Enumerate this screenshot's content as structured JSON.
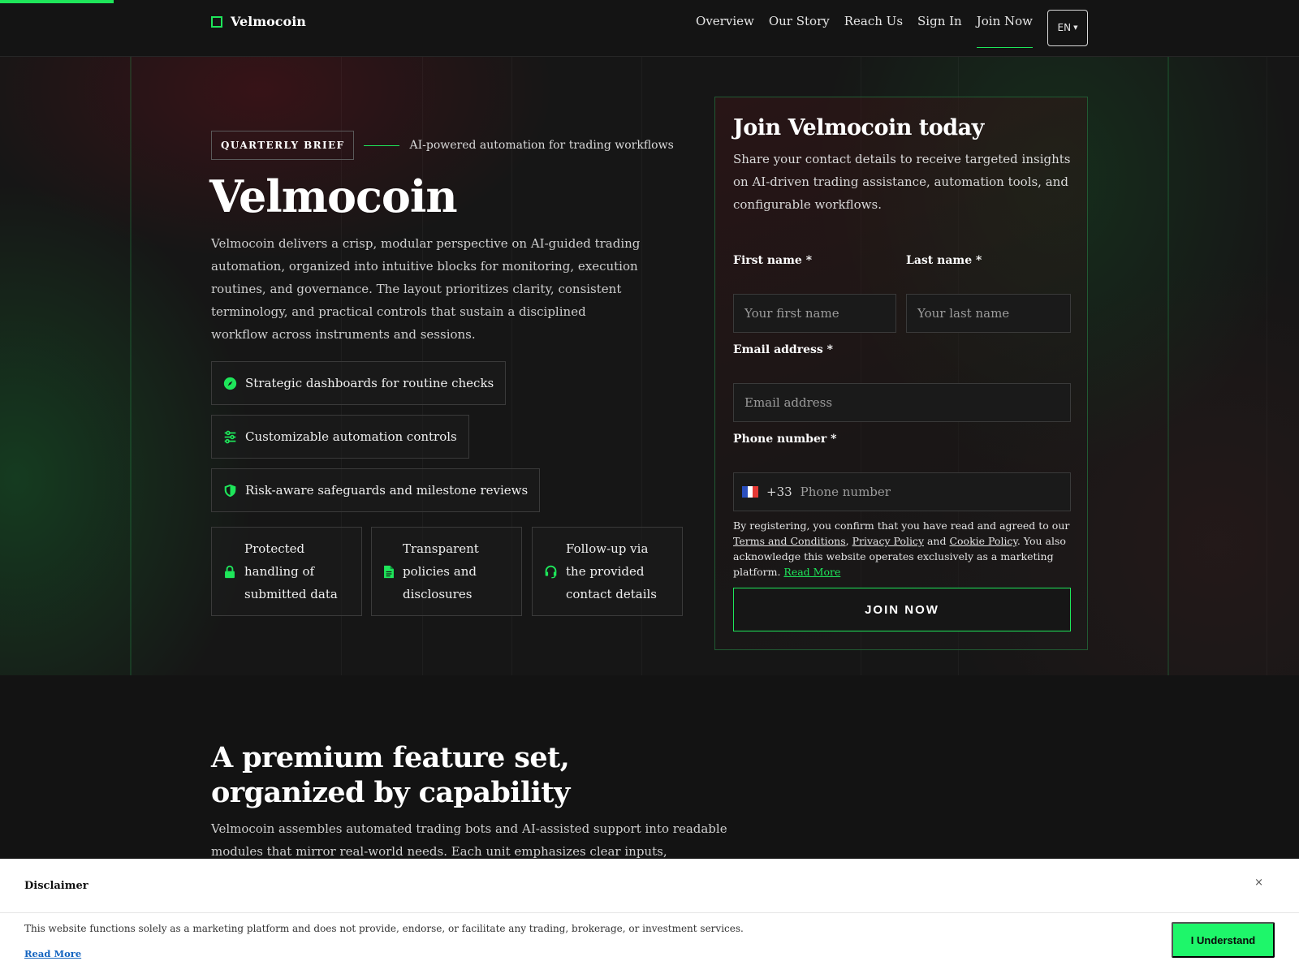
{
  "header": {
    "brand": "Velmocoin",
    "nav": [
      "Overview",
      "Our Story",
      "Reach Us",
      "Sign In",
      "Join Now"
    ],
    "active_nav": "Join Now",
    "language": "EN"
  },
  "hero": {
    "badge": "QUARTERLY BRIEF",
    "tagline": "AI-powered automation for trading workflows",
    "title": "Velmocoin",
    "description": "Velmocoin delivers a crisp, modular perspective on AI-guided trading automation, organized into intuitive blocks for monitoring, execution routines, and governance. The layout prioritizes clarity, consistent terminology, and practical controls that sustain a disciplined workflow across instruments and sessions.",
    "features": [
      {
        "icon": "compass-icon",
        "label": "Strategic dashboards for routine checks"
      },
      {
        "icon": "sliders-icon",
        "label": "Customizable automation controls"
      },
      {
        "icon": "shield-icon",
        "label": "Risk-aware safeguards and milestone reviews"
      }
    ],
    "cards": [
      {
        "icon": "lock-icon",
        "label": "Protected handling of submitted data"
      },
      {
        "icon": "document-icon",
        "label": "Transparent policies and disclosures"
      },
      {
        "icon": "headset-icon",
        "label": "Follow-up via the provided contact details"
      }
    ]
  },
  "form": {
    "title": "Join Velmocoin today",
    "subtitle": "Share your contact details to receive targeted insights on AI-driven trading assistance, automation tools, and configurable workflows.",
    "first_name_label": "First name *",
    "first_name_placeholder": "Your first name",
    "last_name_label": "Last name *",
    "last_name_placeholder": "Your last name",
    "email_label": "Email address *",
    "email_placeholder": "Email address",
    "phone_label": "Phone number *",
    "phone_code": "+33",
    "phone_placeholder": "Phone number",
    "legal_prefix": "By registering, you confirm that you have read and agreed to our ",
    "terms": "Terms and Conditions",
    "comma": ", ",
    "privacy": "Privacy Policy",
    "and": " and ",
    "cookie": "Cookie Policy",
    "legal_suffix": ". You also acknowledge this website operates exclusively as a marketing platform. ",
    "read_more": "Read More",
    "submit": "JOIN NOW"
  },
  "features_section": {
    "title": "A premium feature set, organized by capability",
    "description": "Velmocoin assembles automated trading bots and AI-assisted support into readable modules that mirror real-world needs. Each unit emphasizes clear inputs, repeatable routines, and"
  },
  "disclaimer": {
    "title": "Disclaimer",
    "close": "×",
    "text": "This website functions solely as a marketing platform and does not provide, endorse, or facilitate any trading, brokerage, or investment services.",
    "read_more": "Read More",
    "button": "I Understand"
  },
  "colors": {
    "accent": "#1ee65a",
    "background": "#131313",
    "link": "#1565c0"
  }
}
